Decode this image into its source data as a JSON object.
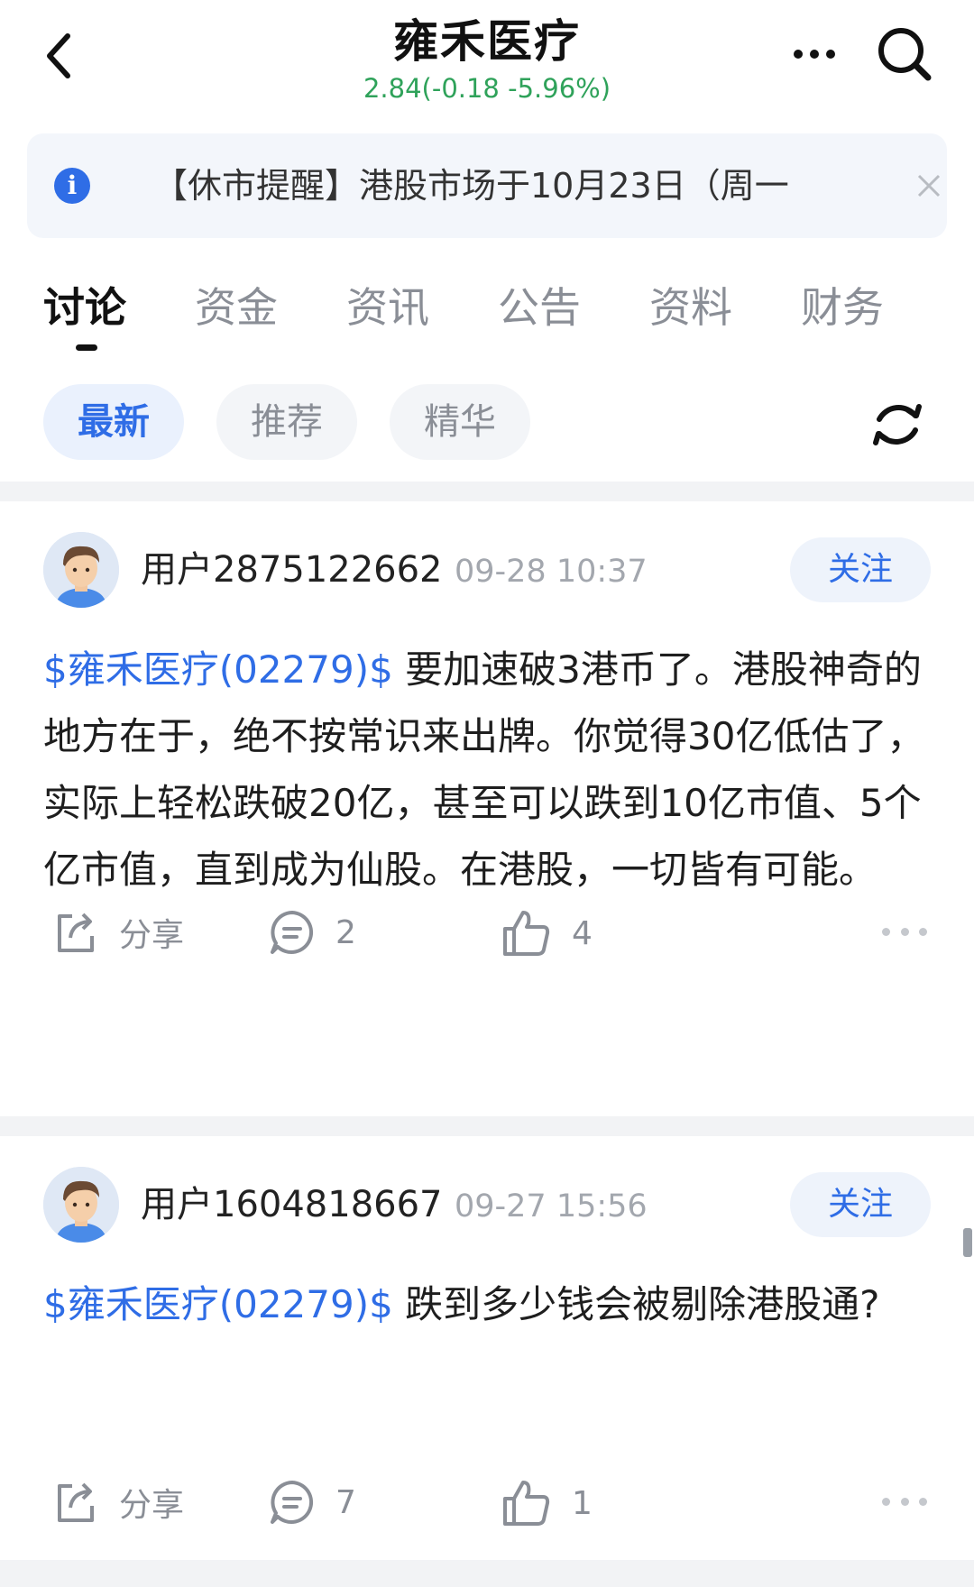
{
  "header": {
    "title": "雍禾医疗",
    "quote": "2.84(-0.18 -5.96%)",
    "quote_color": "#2fa25a"
  },
  "notice": {
    "text": "【休市提醒】港股市场于10月23日（周一"
  },
  "tabs": [
    "讨论",
    "资金",
    "资讯",
    "公告",
    "资料",
    "财务"
  ],
  "active_tab": "讨论",
  "filters": [
    "最新",
    "推荐",
    "精华"
  ],
  "active_filter": "最新",
  "posts": [
    {
      "username": "用户2875122662",
      "time": "09-28 10:37",
      "follow_label": "关注",
      "tag": "$雍禾医疗(02279)$",
      "text": " 要加速破3港币了。港股神奇的地方在于，绝不按常识来出牌。你觉得30亿低估了，实际上轻松跌破20亿，甚至可以跌到10亿市值、5个亿市值，直到成为仙股。在港股，一切皆有可能。",
      "share_label": "分享",
      "comments": "2",
      "likes": "4"
    },
    {
      "username": "用户1604818667",
      "time": "09-27 15:56",
      "follow_label": "关注",
      "tag": "$雍禾医疗(02279)$",
      "text": " 跌到多少钱会被剔除港股通?",
      "share_label": "分享",
      "comments": "7",
      "likes": "1"
    }
  ],
  "colors": {
    "accent": "#2f6de6",
    "down": "#2fa25a",
    "muted": "#8a8e96"
  }
}
